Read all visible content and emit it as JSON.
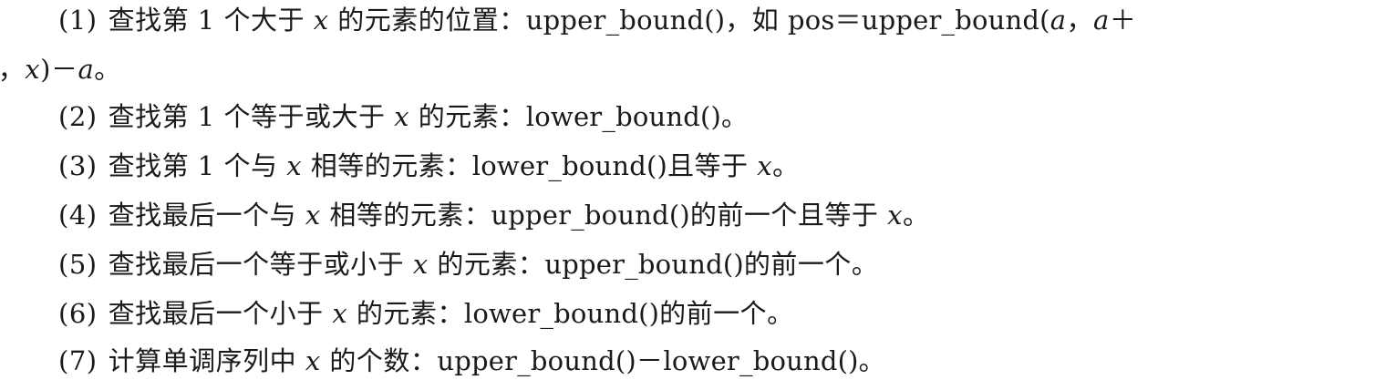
{
  "document": {
    "lines": [
      {
        "num": "(1)",
        "segments": [
          "查找第 1 个大于 ",
          "x",
          " 的元素的位置：",
          "upper_bound()",
          "，如 ",
          "pos＝upper_bound(",
          "a",
          "，",
          "a",
          "＋"
        ]
      },
      {
        "num": "",
        "segments": [
          "ı",
          "，",
          "x",
          ")－",
          "a",
          "。"
        ]
      },
      {
        "num": "(2)",
        "segments": [
          "查找第 1 个等于或大于 ",
          "x",
          " 的元素：",
          "lower_bound()",
          "。"
        ]
      },
      {
        "num": "(3)",
        "segments": [
          "查找第 1 个与 ",
          "x",
          " 相等的元素：",
          "lower_bound()",
          "且等于 ",
          "x",
          "。"
        ]
      },
      {
        "num": "(4)",
        "segments": [
          "查找最后一个与 ",
          "x",
          " 相等的元素：",
          "upper_bound()",
          "的前一个且等于 ",
          "x",
          "。"
        ]
      },
      {
        "num": "(5)",
        "segments": [
          "查找最后一个等于或小于 ",
          "x",
          " 的元素：",
          "upper_bound()",
          "的前一个。"
        ]
      },
      {
        "num": "(6)",
        "segments": [
          "查找最后一个小于 ",
          "x",
          " 的元素：",
          "lower_bound()",
          "的前一个。"
        ]
      },
      {
        "num": "(7)",
        "segments": [
          "计算单调序列中 ",
          "x",
          " 的个数：",
          "upper_bound()",
          "－",
          "lower_bound()",
          "。"
        ]
      }
    ]
  }
}
